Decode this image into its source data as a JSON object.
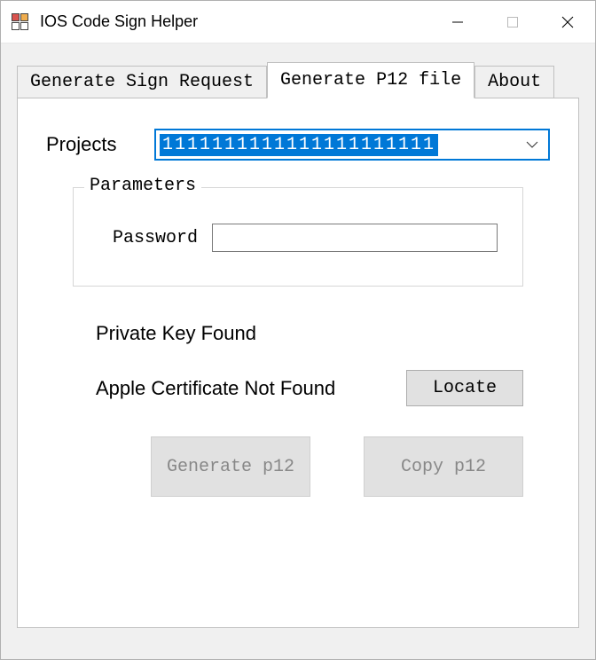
{
  "window": {
    "title": "IOS Code Sign Helper"
  },
  "tabs": {
    "items": [
      {
        "label": "Generate Sign Request",
        "active": false
      },
      {
        "label": "Generate P12 file",
        "active": true
      },
      {
        "label": "About",
        "active": false
      }
    ]
  },
  "form": {
    "projects_label": "Projects",
    "projects_value": "1111111111111111111111",
    "parameters_legend": "Parameters",
    "password_label": "Password",
    "password_value": ""
  },
  "status": {
    "private_key": "Private Key Found",
    "certificate": "Apple Certificate Not Found",
    "locate_label": "Locate"
  },
  "actions": {
    "generate_label": "Generate p12",
    "copy_label": "Copy p12"
  },
  "colors": {
    "accent": "#0078d7"
  }
}
